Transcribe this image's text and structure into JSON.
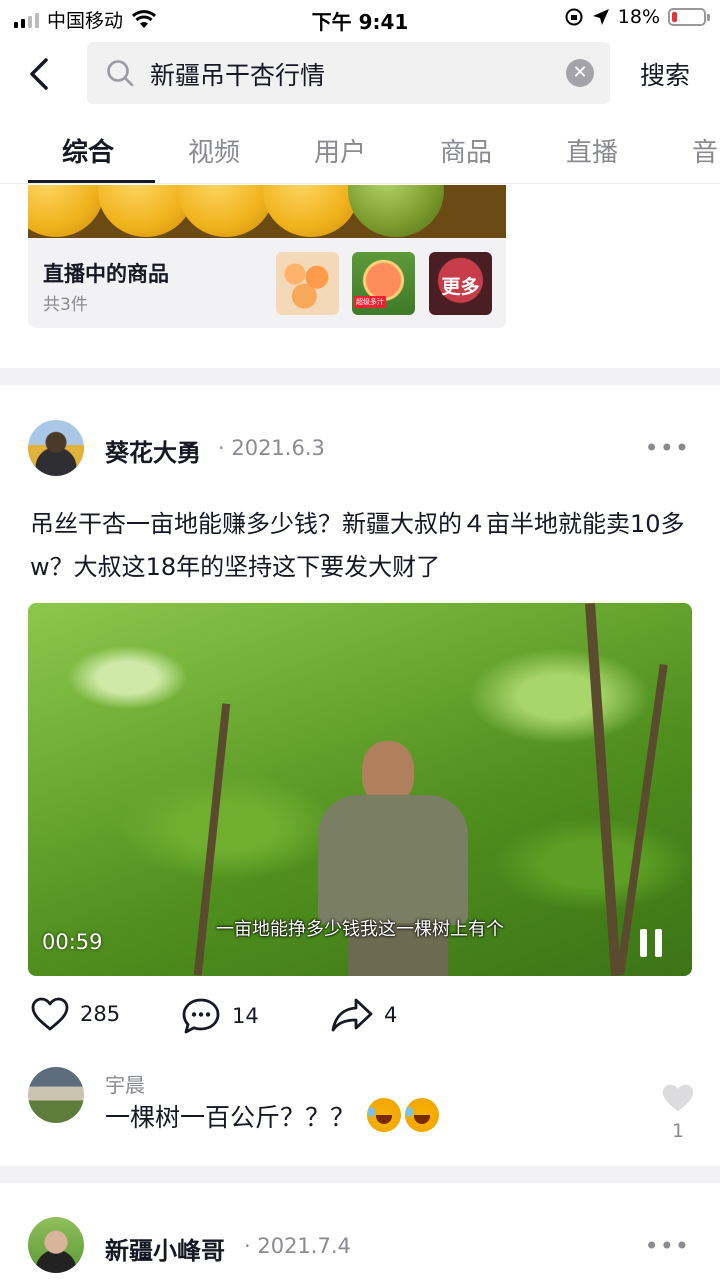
{
  "status_bar": {
    "carrier": "中国移动",
    "time": "下午 9:41",
    "battery": "18%",
    "battery_level": 0.18
  },
  "search": {
    "query": "新疆吊干杏行情",
    "button": "搜索"
  },
  "tabs": [
    "综合",
    "视频",
    "用户",
    "商品",
    "直播",
    "音"
  ],
  "active_tab": 0,
  "goods_card": {
    "title": "直播中的商品",
    "count": "共3件",
    "thumb3_label": "更多",
    "thumb2_tag": "超级多汁"
  },
  "post1": {
    "author": "葵花大勇",
    "date": "· 2021.6.3",
    "text": "吊丝干杏一亩地能赚多少钱？新疆大叔的４亩半地就能卖10多w？大叔这18年的坚持这下要发大财了",
    "video": {
      "duration": "00:59",
      "subtitle": "一亩地能挣多少钱我这一棵树上有个"
    },
    "likes": "285",
    "comments": "14",
    "shares": "4",
    "top_comment": {
      "user": "宇晨",
      "text": "一棵树一百公斤？？？",
      "likes": "1"
    }
  },
  "post2": {
    "author": "新疆小峰哥",
    "date": "· 2021.7.4"
  },
  "icons": [
    "signal-icon",
    "wifi-icon",
    "orientation-lock-icon",
    "location-icon",
    "battery-icon",
    "back-icon",
    "search-icon",
    "clear-icon",
    "more-icon",
    "like-icon",
    "comment-icon",
    "share-icon",
    "pause-icon"
  ],
  "colors": {
    "text": "#161823",
    "secondary": "#8a8b91",
    "battery_low": "#e8333a",
    "search_bg": "#f1f1f2"
  }
}
